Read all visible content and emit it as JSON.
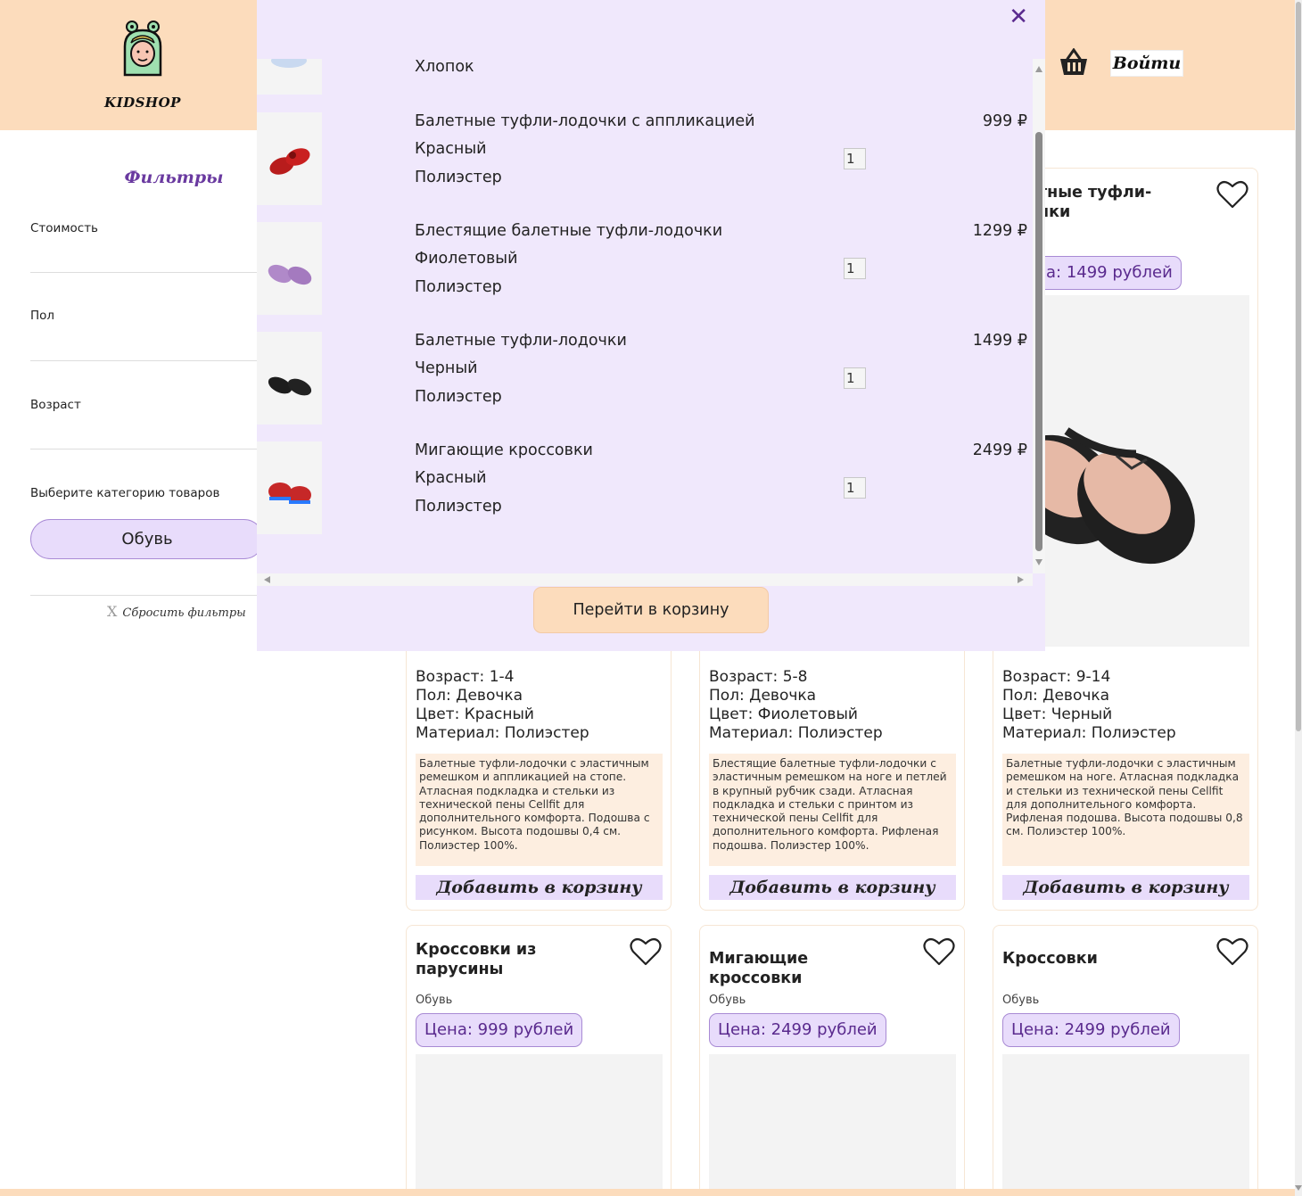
{
  "header": {
    "logo_text": "KIDSHOP",
    "login_label": "Войти"
  },
  "sidebar": {
    "title": "Фильтры",
    "filters": [
      {
        "label": "Стоимость"
      },
      {
        "label": "Пол"
      },
      {
        "label": "Возраст"
      },
      {
        "label": "Выберите категорию товаров"
      }
    ],
    "category_selected": "Обувь",
    "reset_label": "Сбросить фильтры"
  },
  "cart": {
    "partial_item_material": "Хлопок",
    "items": [
      {
        "name": "Балетные туфли-лодочки с аппликацией",
        "color": "Красный",
        "material": "Полиэстер",
        "price": "999 ₽",
        "qty": "1"
      },
      {
        "name": "Блестящие балетные туфли-лодочки",
        "color": "Фиолетовый",
        "material": "Полиэстер",
        "price": "1299 ₽",
        "qty": "1"
      },
      {
        "name": "Балетные туфли-лодочки",
        "color": "Черный",
        "material": "Полиэстер",
        "price": "1499 ₽",
        "qty": "1"
      },
      {
        "name": "Мигающие кроссовки",
        "color": "Красный",
        "material": "Полиэстер",
        "price": "2499 ₽",
        "qty": "1"
      }
    ],
    "goto_label": "Перейти в корзину"
  },
  "cards_top": [
    {
      "age": "Возраст: 1-4",
      "gender": "Пол: Девочка",
      "color": "Цвет: Красный",
      "material": "Материал: Полиэстер",
      "description": "Балетные туфли-лодочки с эластичным ремешком и аппликацией на стопе. Атласная подкладка и стельки из технической пены Cellfit для дополнительного комфорта. Подошва с рисунком. Высота подошвы 0,4 см. Полиэстер 100%.",
      "add_label": "Добавить в корзину"
    },
    {
      "age": "Возраст: 5-8",
      "gender": "Пол: Девочка",
      "color": "Цвет: Фиолетовый",
      "material": "Материал: Полиэстер",
      "description": "Блестящие балетные туфли-лодочки с эластичным ремешком на ноге и петлей в крупный рубчик сзади. Атласная подкладка и стельки с принтом из технической пены Cellfit для дополнительного комфорта. Рифленая подошва. Полиэстер 100%.",
      "add_label": "Добавить в корзину"
    },
    {
      "title_visible": "тные туфли-\nнки",
      "price_visible": "а: 1499 рублей",
      "age": "Возраст: 9-14",
      "gender": "Пол: Девочка",
      "color": "Цвет: Черный",
      "material": "Материал: Полиэстер",
      "description": "Балетные туфли-лодочки с эластичным ремешком на ноге. Атласная подкладка и стельки из технической пены Cellfit для дополнительного комфорта. Рифленая подошва. Высота подошвы 0,8 см. Полиэстер 100%.",
      "add_label": "Добавить в корзину"
    }
  ],
  "cards_bottom": [
    {
      "title": "Кроссовки из парусины",
      "category": "Обувь",
      "price": "Цена: 999 рублей"
    },
    {
      "title": "Мигающие кроссовки",
      "category": "Обувь",
      "price": "Цена: 2499 рублей"
    },
    {
      "title": "Кроссовки",
      "category": "Обувь",
      "price": "Цена: 2499 рублей"
    }
  ],
  "colors": {
    "header_bg": "#fcdcbc",
    "accent_purple": "#5a2a8e",
    "lavender": "#e8dcfb",
    "cart_bg": "#f0e8fc"
  }
}
